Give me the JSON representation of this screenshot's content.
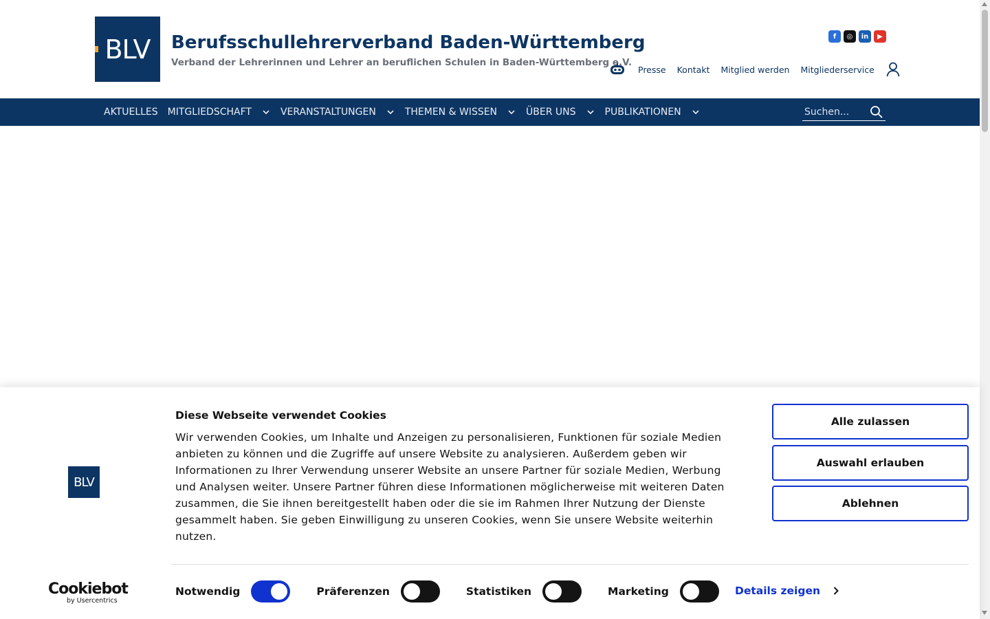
{
  "header": {
    "logo_text": "BLV",
    "title": "Berufsschullehrerverband Baden-Württemberg",
    "subtitle": "Verband der Lehrerinnen und Lehrer an beruflichen Schulen in Baden-Württemberg e.V.",
    "social": [
      {
        "name": "facebook-icon",
        "glyph": "f"
      },
      {
        "name": "instagram-icon",
        "glyph": "◎"
      },
      {
        "name": "linkedin-icon",
        "glyph": "in"
      },
      {
        "name": "youtube-icon",
        "glyph": "▶"
      }
    ],
    "utility_links": [
      "Presse",
      "Kontakt",
      "Mitglied werden",
      "Mitgliederservice"
    ]
  },
  "nav": {
    "items": [
      {
        "label": "AKTUELLES",
        "dropdown": false
      },
      {
        "label": "MITGLIEDSCHAFT",
        "dropdown": true
      },
      {
        "label": "VERANSTALTUNGEN",
        "dropdown": true
      },
      {
        "label": "THEMEN & WISSEN",
        "dropdown": true
      },
      {
        "label": "ÜBER UNS",
        "dropdown": true
      },
      {
        "label": "PUBLIKATIONEN",
        "dropdown": true
      }
    ],
    "search_placeholder": "Suchen..."
  },
  "cookie": {
    "logo_text": "BLV",
    "heading": "Diese Webseite verwendet Cookies",
    "body": "Wir verwenden Cookies, um Inhalte und Anzeigen zu personalisieren, Funktionen für soziale Medien anbieten zu können und die Zugriffe auf unsere Website zu analysieren. Außerdem geben wir Informationen zu Ihrer Verwendung unserer Website an unsere Partner für soziale Medien, Werbung und Analysen weiter. Unsere Partner führen diese Informationen möglicherweise mit weiteren Daten zusammen, die Sie ihnen bereitgestellt haben oder die sie im Rahmen Ihrer Nutzung der Dienste gesammelt haben. Sie geben Einwilligung zu unseren Cookies, wenn Sie unsere Website weiterhin nutzen.",
    "buttons": {
      "allow_all": "Alle zulassen",
      "allow_selection": "Auswahl erlauben",
      "deny": "Ablehnen"
    },
    "toggles": [
      {
        "label": "Notwendig",
        "on": true
      },
      {
        "label": "Präferenzen",
        "on": false
      },
      {
        "label": "Statistiken",
        "on": false
      },
      {
        "label": "Marketing",
        "on": false
      }
    ],
    "details_label": "Details zeigen",
    "brand": {
      "name": "Cookiebot",
      "sub": "by Usercentrics"
    }
  },
  "colors": {
    "brand_navy": "#0d3563",
    "cookie_accent": "#1032cf",
    "logo_accent": "#f5a623"
  }
}
